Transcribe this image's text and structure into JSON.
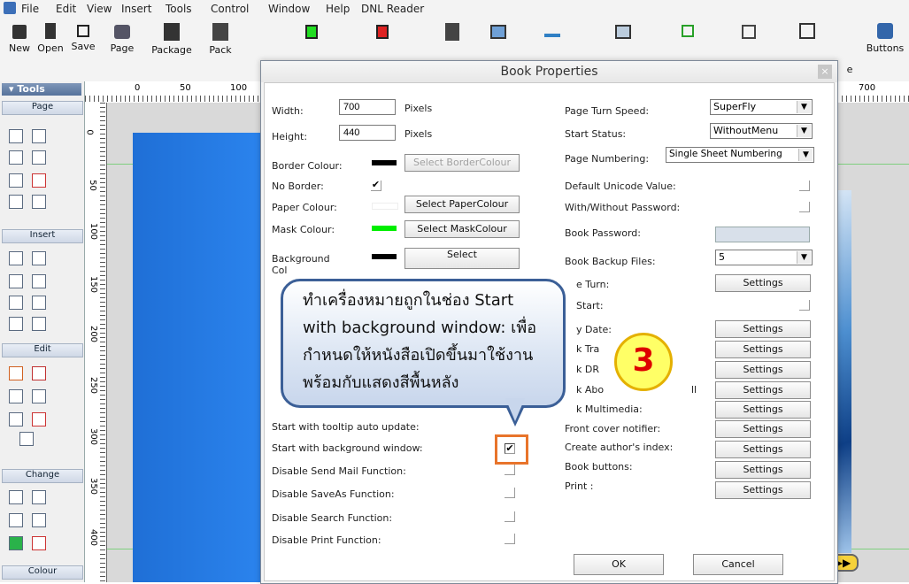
{
  "menu": [
    "File",
    "Edit",
    "View",
    "Insert",
    "Tools",
    "Control",
    "Window",
    "Help",
    "DNL Reader"
  ],
  "toolbar": {
    "new": "New",
    "open": "Open",
    "save": "Save",
    "page": "Page",
    "package": "Package",
    "pack": "Pack",
    "partial_e": "e",
    "buttons": "Buttons"
  },
  "tools_panel": {
    "header": "Tools",
    "sections": [
      "Page",
      "Insert",
      "Edit",
      "Change",
      "Colour"
    ]
  },
  "ruler": {
    "top": [
      "0",
      "50",
      "100",
      "700"
    ],
    "left": [
      "0",
      "50",
      "100",
      "150",
      "200",
      "250",
      "300",
      "350",
      "400"
    ]
  },
  "dialog": {
    "title": "Book Properties",
    "close": "×",
    "left": {
      "width_label": "Width:",
      "width_value": "700",
      "width_unit": "Pixels",
      "height_label": "Height:",
      "height_value": "440",
      "height_unit": "Pixels",
      "border_colour_label": "Border Colour:",
      "border_colour_btn": "Select BorderColour",
      "no_border_label": "No Border:",
      "paper_colour_label": "Paper Colour:",
      "paper_colour_btn": "Select PaperColour",
      "mask_colour_label": "Mask Colour:",
      "mask_colour_btn": "Select MaskColour",
      "background_label": "Background",
      "background_label2": "Col",
      "background_btn": "Select",
      "tooltip_label": "Start with tooltip auto update:",
      "bg_window_label": "Start with background window:",
      "disable_sendmail": "Disable Send Mail Function:",
      "disable_saveas": "Disable SaveAs Function:",
      "disable_search": "Disable Search Function:",
      "disable_print": "Disable Print Function:"
    },
    "right": {
      "turn_speed_label": "Page Turn Speed:",
      "turn_speed_value": "SuperFly",
      "start_status_label": "Start Status:",
      "start_status_value": "WithoutMenu",
      "numbering_label": "Page Numbering:",
      "numbering_value": "Single Sheet Numbering",
      "unicode_label": "Default Unicode Value:",
      "password_toggle_label": "With/Without Password:",
      "password_label": "Book Password:",
      "backup_label": "Book Backup Files:",
      "backup_value": "5",
      "page_turn_label": "e Turn:",
      "start_label": "Start:",
      "expiry_label": "y Date:",
      "tra_label": "k Tra",
      "dr_label": "k DR",
      "about_label": "k Abo",
      "about_tail": "ll",
      "multimedia_label": "k Multimedia:",
      "front_cover_label": "Front cover notifier:",
      "author_index_label": "Create author's index:",
      "book_buttons_label": "Book buttons:",
      "print_label": "Print :",
      "settings": "Settings"
    },
    "ok": "OK",
    "cancel": "Cancel"
  },
  "callout": {
    "lines": [
      "ทำเครื่องหมายถูกในช่อง Start",
      "with background window: เพื่อ",
      "กำหนดให้หนังสือเปิดขึ้นมาใช้งาน",
      "พร้อมกับแสดงสีพื้นหลัง"
    ]
  },
  "step_badge": "3",
  "colors": {
    "border_swatch": "#000000",
    "paper_swatch": "#ffffff",
    "mask_swatch": "#00ee00",
    "bg_swatch": "#000000",
    "highlight": "#e8742b",
    "callout_border": "#3b5f97",
    "badge_fill": "#ffff66",
    "badge_text": "#dd0000"
  },
  "icons": [
    "new-icon",
    "open-icon",
    "save-icon",
    "page-icon",
    "package-icon",
    "lock-icon",
    "buttons-icon"
  ]
}
